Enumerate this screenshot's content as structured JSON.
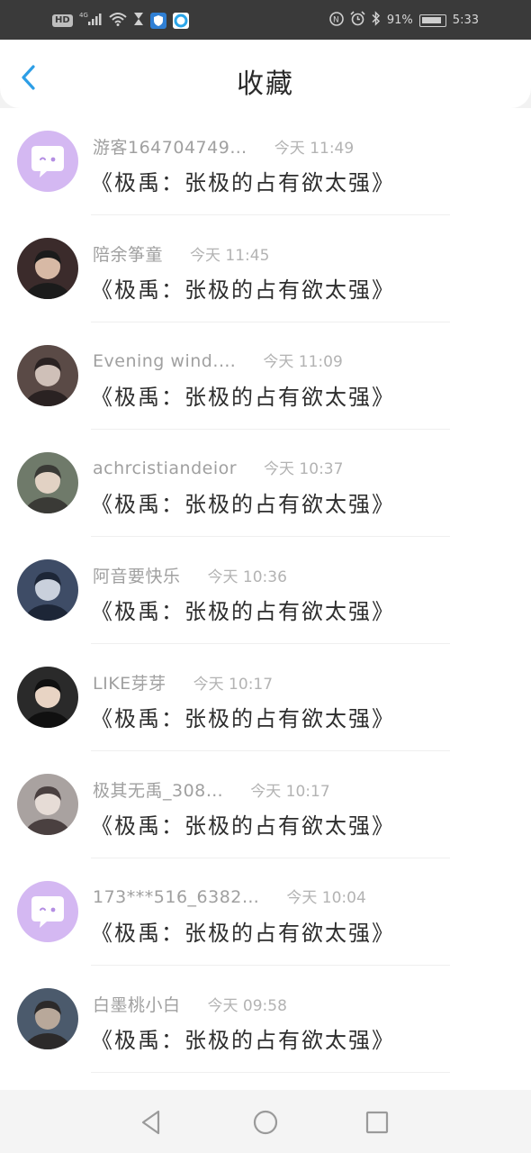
{
  "status_bar": {
    "hd_badge": "HD",
    "network": "4G",
    "battery_percent": "91%",
    "battery_level": 0.91,
    "time": "5:33",
    "icons": [
      "hd-icon",
      "signal-icon",
      "wifi-icon",
      "hourglass-icon",
      "shield-app-icon",
      "browser-app-icon",
      "nfc-icon",
      "alarm-icon",
      "bluetooth-icon",
      "battery-icon"
    ]
  },
  "header": {
    "title": "收藏",
    "back_icon": "chevron-left-icon",
    "accent_color": "#2d9ee6"
  },
  "items": [
    {
      "username": "游客164704749…",
      "time": "今天 11:49",
      "title": "《极禹：张极的占有欲太强》",
      "avatar": "default-chat-avatar"
    },
    {
      "username": "陪余筝童",
      "time": "今天 11:45",
      "title": "《极禹：张极的占有欲太强》",
      "avatar": "photo-avatar"
    },
    {
      "username": "Evening wind.…",
      "time": "今天 11:09",
      "title": "《极禹：张极的占有欲太强》",
      "avatar": "photo-avatar"
    },
    {
      "username": "achrcistiandeior",
      "time": "今天 10:37",
      "title": "《极禹：张极的占有欲太强》",
      "avatar": "photo-avatar"
    },
    {
      "username": "阿音要快乐",
      "time": "今天 10:36",
      "title": "《极禹：张极的占有欲太强》",
      "avatar": "photo-avatar"
    },
    {
      "username": "LIKE芽芽",
      "time": "今天 10:17",
      "title": "《极禹：张极的占有欲太强》",
      "avatar": "photo-avatar"
    },
    {
      "username": "极其无禹_308…",
      "time": "今天 10:17",
      "title": "《极禹：张极的占有欲太强》",
      "avatar": "photo-avatar"
    },
    {
      "username": "173***516_6382…",
      "time": "今天 10:04",
      "title": "《极禹：张极的占有欲太强》",
      "avatar": "default-chat-avatar"
    },
    {
      "username": "白墨桃小白",
      "time": "今天 09:58",
      "title": "《极禹：张极的占有欲太强》",
      "avatar": "photo-avatar"
    }
  ],
  "nav": {
    "back_icon": "triangle-back-icon",
    "home_icon": "circle-home-icon",
    "recents_icon": "square-recents-icon"
  }
}
